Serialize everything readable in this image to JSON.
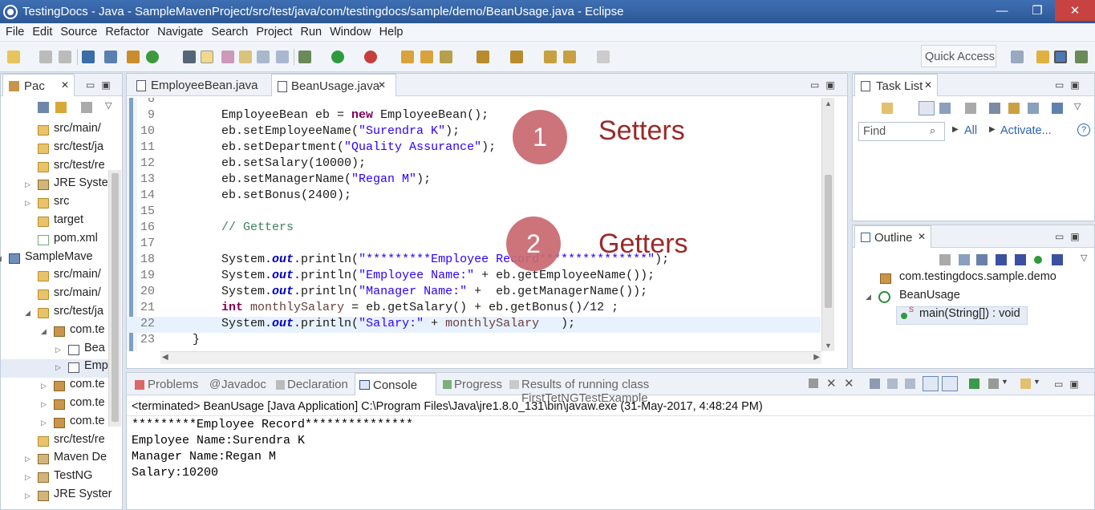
{
  "window": {
    "title": "TestingDocs - Java - SampleMavenProject/src/test/java/com/testingdocs/sample/demo/BeanUsage.java - Eclipse"
  },
  "menu": [
    "File",
    "Edit",
    "Source",
    "Refactor",
    "Navigate",
    "Search",
    "Project",
    "Run",
    "Window",
    "Help"
  ],
  "toolbar": {
    "quick_access": "Quick Access"
  },
  "package_explorer": {
    "tab_label": "Pac",
    "rows": [
      {
        "label": "src/main/",
        "icon": "folder-icon"
      },
      {
        "label": "src/test/ja",
        "icon": "folder-icon"
      },
      {
        "label": "src/test/re",
        "icon": "folder-icon"
      },
      {
        "label": "JRE Syster",
        "icon": "library-icon"
      },
      {
        "label": "src",
        "icon": "folder-icon"
      },
      {
        "label": "target",
        "icon": "folder-icon"
      },
      {
        "label": "pom.xml",
        "icon": "xml-file-icon"
      },
      {
        "label": "SampleMave",
        "icon": "project-icon"
      },
      {
        "label": "src/main/",
        "icon": "folder-icon"
      },
      {
        "label": "src/main/",
        "icon": "folder-icon"
      },
      {
        "label": "src/test/ja",
        "icon": "folder-icon"
      },
      {
        "label": "com.te",
        "icon": "package-icon"
      },
      {
        "label": "Bea",
        "icon": "java-file-icon"
      },
      {
        "label": "Emp",
        "icon": "java-file-icon"
      },
      {
        "label": "com.te",
        "icon": "package-icon"
      },
      {
        "label": "com.te",
        "icon": "package-icon"
      },
      {
        "label": "com.te",
        "icon": "package-icon"
      },
      {
        "label": "src/test/re",
        "icon": "folder-icon"
      },
      {
        "label": "Maven De",
        "icon": "library-icon"
      },
      {
        "label": "TestNG",
        "icon": "library-icon"
      },
      {
        "label": "JRE Syster",
        "icon": "library-icon"
      }
    ]
  },
  "editor": {
    "tabs": [
      {
        "label": "EmployeeBean.java",
        "active": false
      },
      {
        "label": "BeanUsage.java",
        "active": true
      }
    ],
    "lines": [
      {
        "n": "8",
        "code": ""
      },
      {
        "n": "9",
        "code": "        EmployeeBean eb = new EmployeeBean();"
      },
      {
        "n": "10",
        "code": "        eb.setEmployeeName(\"Surendra K\");"
      },
      {
        "n": "11",
        "code": "        eb.setDepartment(\"Quality Assurance\");"
      },
      {
        "n": "12",
        "code": "        eb.setSalary(10000);"
      },
      {
        "n": "13",
        "code": "        eb.setManagerName(\"Regan M\");"
      },
      {
        "n": "14",
        "code": "        eb.setBonus(2400);"
      },
      {
        "n": "15",
        "code": ""
      },
      {
        "n": "16",
        "code": "        // Getters"
      },
      {
        "n": "17",
        "code": ""
      },
      {
        "n": "18",
        "code": "        System.out.println(\"*********Employee Record***************\");"
      },
      {
        "n": "19",
        "code": "        System.out.println(\"Employee Name:\" + eb.getEmployeeName());"
      },
      {
        "n": "20",
        "code": "        System.out.println(\"Manager Name:\" +  eb.getManagerName());"
      },
      {
        "n": "21",
        "code": "        int monthlySalary = eb.getSalary() + eb.getBonus()/12 ;"
      },
      {
        "n": "22",
        "code": "        System.out.println(\"Salary:\" + monthlySalary   );"
      },
      {
        "n": "23",
        "code": "    }"
      }
    ],
    "annotations": [
      {
        "number": "1",
        "label": "Setters"
      },
      {
        "number": "2",
        "label": "Getters"
      }
    ]
  },
  "task_list": {
    "tab_label": "Task List",
    "find_placeholder": "Find",
    "all_label": "All",
    "activate_label": "Activate..."
  },
  "outline": {
    "tab_label": "Outline",
    "items": [
      {
        "label": "com.testingdocs.sample.demo"
      },
      {
        "label": "BeanUsage"
      },
      {
        "label": "main(String[]) : void"
      }
    ]
  },
  "console": {
    "tabs": [
      {
        "label": "Problems"
      },
      {
        "label": "Javadoc"
      },
      {
        "label": "Declaration"
      },
      {
        "label": "Console"
      },
      {
        "label": "Progress"
      },
      {
        "label": "Results of running class FirstTetNGTestExample"
      }
    ],
    "header": "<terminated> BeanUsage [Java Application] C:\\Program Files\\Java\\jre1.8.0_131\\bin\\javaw.exe (31-May-2017, 4:48:24 PM)",
    "output": [
      "*********Employee Record***************",
      "Employee Name:Surendra K",
      "Manager Name:Regan M",
      "Salary:10200"
    ]
  }
}
